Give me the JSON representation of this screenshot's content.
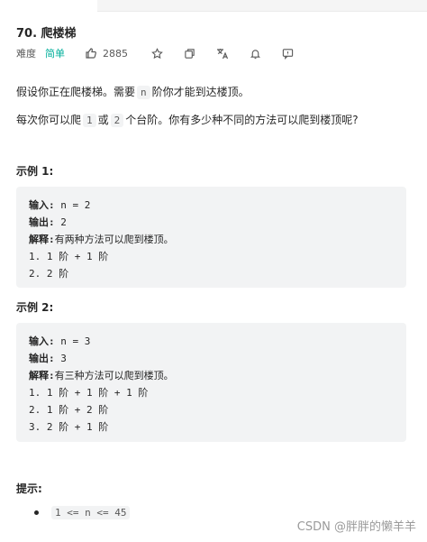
{
  "problem": {
    "title": "70. 爬楼梯",
    "difficulty_label": "难度",
    "difficulty": "简单",
    "likes": "2885"
  },
  "description": {
    "p1_before": "假设你正在爬楼梯。需要",
    "p1_code": "n",
    "p1_after": "阶你才能到达楼顶。",
    "p2_before": "每次你可以爬",
    "p2_code1": "1",
    "p2_mid": "或",
    "p2_code2": "2",
    "p2_after": "个台阶。你有多少种不同的方法可以爬到楼顶呢?"
  },
  "examples": [
    {
      "title": "示例 1:",
      "input_key": "输入:",
      "input_val": " n = 2",
      "output_key": "输出:",
      "output_val": " 2",
      "explain_key": "解释:",
      "explain_val": "有两种方法可以爬到楼顶。",
      "steps": [
        "1. 1 阶 + 1 阶",
        "2. 2 阶"
      ]
    },
    {
      "title": "示例 2:",
      "input_key": "输入:",
      "input_val": " n = 3",
      "output_key": "输出:",
      "output_val": " 3",
      "explain_key": "解释:",
      "explain_val": "有三种方法可以爬到楼顶。",
      "steps": [
        "1. 1 阶 + 1 阶 + 1 阶",
        "2. 1 阶 + 2 阶",
        "3. 2 阶 + 1 阶"
      ]
    }
  ],
  "hints": {
    "title": "提示:",
    "items": [
      "1 <= n <= 45"
    ]
  },
  "watermark": "CSDN @胖胖的懒羊羊",
  "colors": {
    "difficulty_easy": "#00af9b",
    "code_bg": "#f2f3f4",
    "text": "#262626"
  },
  "icons": [
    "thumbs-up-icon",
    "star-icon",
    "share-icon",
    "translate-icon",
    "bell-icon",
    "feedback-icon"
  ]
}
